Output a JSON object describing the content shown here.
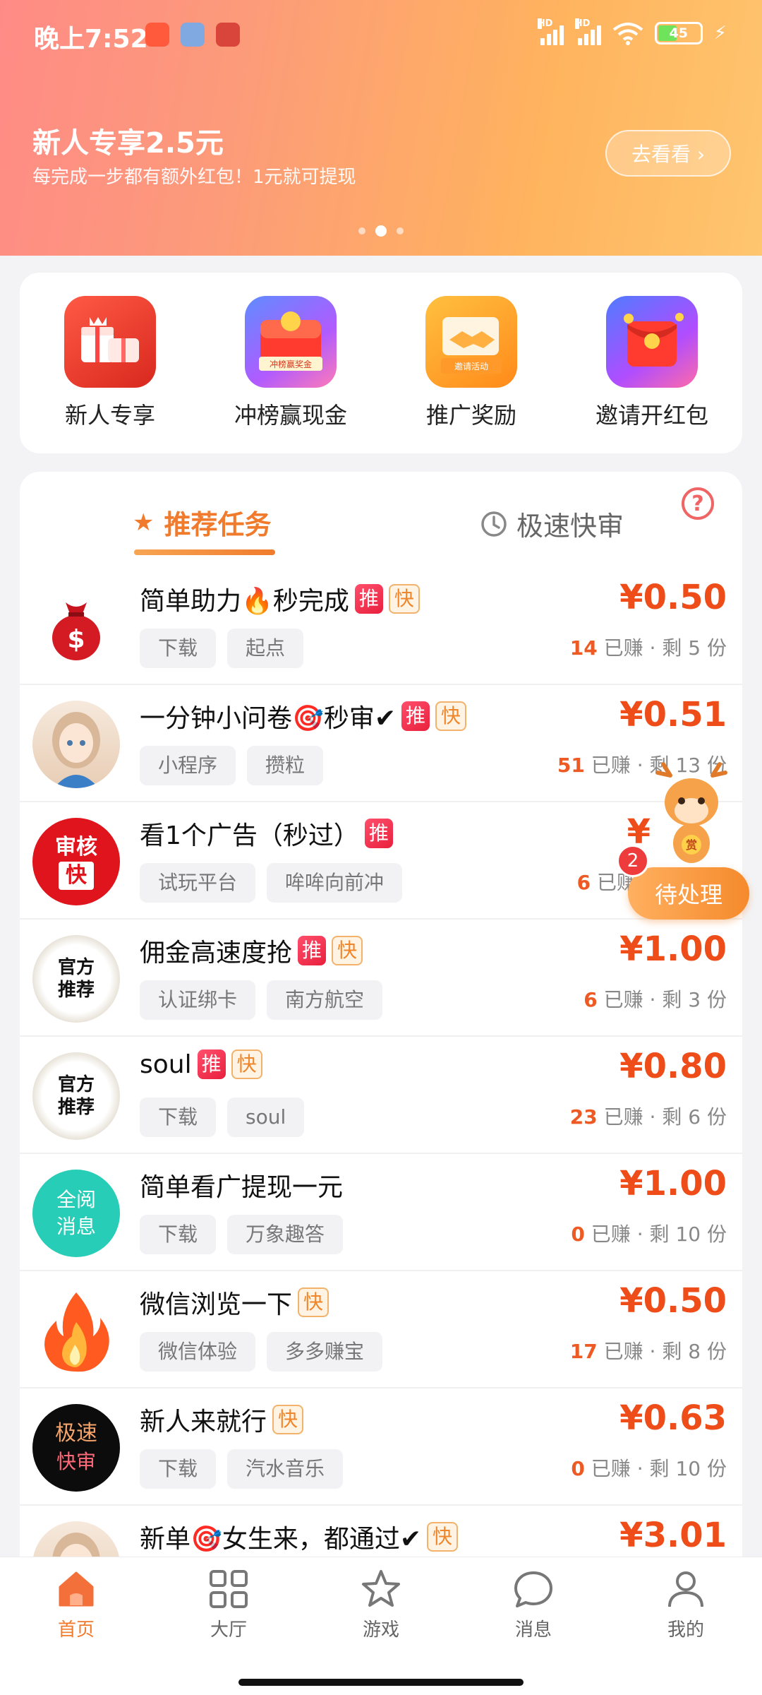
{
  "status_bar": {
    "time": "晚上7:52",
    "hd1": "HD",
    "hd2": "HD",
    "battery": "45",
    "battery_color": "#6ee35b"
  },
  "banner": {
    "title": "新人专享2.5元",
    "subtitle": "每完成一步都有额外红包！1元就可提现",
    "button": "去看看 ›",
    "dots": 3,
    "active_dot": 1
  },
  "quick_entries": [
    {
      "label": "新人专享",
      "icon": "gift-boxes-icon"
    },
    {
      "label": "冲榜赢现金",
      "icon": "cash-prize-icon",
      "caption": "冲榜赢奖金"
    },
    {
      "label": "推广奖励",
      "icon": "handshake-icon",
      "caption": "邀请活动"
    },
    {
      "label": "邀请开红包",
      "icon": "red-envelope-icon"
    }
  ],
  "tabs": {
    "recommended": "推荐任务",
    "fast_review": "极速快审",
    "help": "?"
  },
  "task_labels": {
    "earned": "已赚",
    "sep": "·",
    "remain_prefix": "剩",
    "remain_suffix": "份"
  },
  "tasks": [
    {
      "title": "简单助力🔥秒完成",
      "tui": true,
      "kuai": true,
      "tags": [
        "下载",
        "起点"
      ],
      "price": "¥0.50",
      "earned": "14",
      "remain": "5",
      "avatar": "money-bag"
    },
    {
      "title": "一分钟小问卷🎯秒审✔",
      "tui": true,
      "kuai": true,
      "tags": [
        "小程序",
        "攒粒"
      ],
      "price": "¥0.51",
      "earned": "51",
      "remain": "13",
      "avatar": "anime-girl"
    },
    {
      "title": "看1个广告（秒过）",
      "tui": true,
      "kuai": false,
      "tags": [
        "试玩平台",
        "哞哞向前冲"
      ],
      "price": "¥",
      "earned": "6",
      "remain": "",
      "avatar": "review-fast",
      "avatar_text": [
        "审核",
        "快"
      ]
    },
    {
      "title": "佣金高速度抢",
      "tui": true,
      "kuai": true,
      "tags": [
        "认证绑卡",
        "南方航空"
      ],
      "price": "¥1.00",
      "earned": "6",
      "remain": "3",
      "avatar": "official",
      "avatar_text": [
        "官方",
        "推荐"
      ]
    },
    {
      "title": "soul",
      "tui": true,
      "kuai": true,
      "tags": [
        "下载",
        "soul"
      ],
      "price": "¥0.80",
      "earned": "23",
      "remain": "6",
      "avatar": "official",
      "avatar_text": [
        "官方",
        "推荐"
      ]
    },
    {
      "title": "简单看广提现一元",
      "tui": false,
      "kuai": false,
      "tags": [
        "下载",
        "万象趣答"
      ],
      "price": "¥1.00",
      "earned": "0",
      "remain": "10",
      "avatar": "quanyue",
      "avatar_text": [
        "全阅",
        "消息"
      ]
    },
    {
      "title": "微信浏览一下",
      "tui": false,
      "kuai": true,
      "tags": [
        "微信体验",
        "多多赚宝"
      ],
      "price": "¥0.50",
      "earned": "17",
      "remain": "8",
      "avatar": "flame"
    },
    {
      "title": "新人来就行",
      "tui": false,
      "kuai": true,
      "tags": [
        "下载",
        "汽水音乐"
      ],
      "price": "¥0.63",
      "earned": "0",
      "remain": "10",
      "avatar": "fast-review-black",
      "avatar_text": [
        "极速",
        "快审"
      ]
    },
    {
      "title": "新单🎯女生来，都通过✔",
      "tui": false,
      "kuai": true,
      "tags": [],
      "price": "¥3.01",
      "earned": "",
      "remain": "",
      "avatar": "anime-girl"
    }
  ],
  "badges": {
    "tui": "推",
    "kuai": "快"
  },
  "floating": {
    "pending_label": "待处理",
    "pending_count": "2",
    "mascot_text": "赏"
  },
  "bottom_nav": [
    {
      "label": "首页",
      "icon": "home-icon",
      "active": true
    },
    {
      "label": "大厅",
      "icon": "grid-icon",
      "active": false
    },
    {
      "label": "游戏",
      "icon": "star-icon",
      "active": false
    },
    {
      "label": "消息",
      "icon": "chat-bubble-icon",
      "active": false
    },
    {
      "label": "我的",
      "icon": "person-icon",
      "active": false
    }
  ],
  "colors": {
    "accent": "#f07b2d",
    "price": "#ee4d1a",
    "banner_start": "#ff8b86",
    "banner_end": "#ffc56f"
  }
}
